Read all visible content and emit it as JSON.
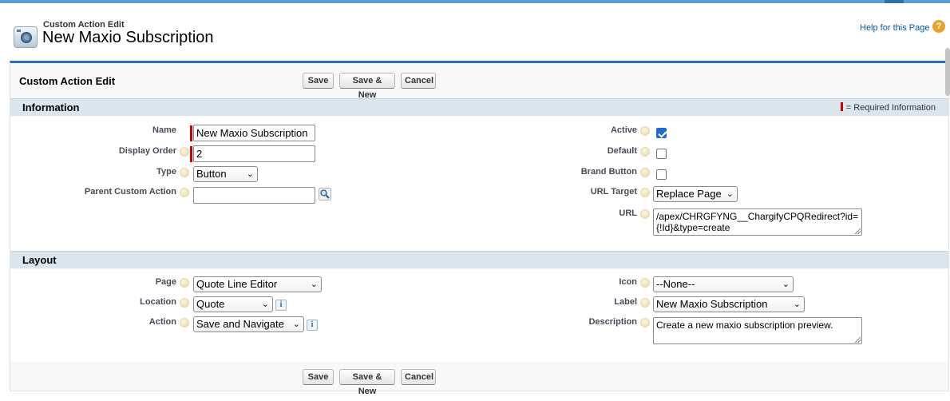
{
  "header": {
    "subtitle": "Custom Action Edit",
    "title": "New Maxio Subscription",
    "help_link": "Help for this Page",
    "help_icon": "?"
  },
  "page_block": {
    "title": "Custom Action Edit",
    "buttons": {
      "save": "Save",
      "save_new": "Save & New",
      "cancel": "Cancel"
    }
  },
  "information": {
    "heading": "Information",
    "required_legend": "= Required Information",
    "fields": {
      "name": {
        "label": "Name",
        "value": "New Maxio Subscription"
      },
      "display_order": {
        "label": "Display Order",
        "value": "2"
      },
      "type": {
        "label": "Type",
        "value": "Button"
      },
      "parent_custom_action": {
        "label": "Parent Custom Action",
        "value": ""
      },
      "active": {
        "label": "Active",
        "checked": true
      },
      "default": {
        "label": "Default",
        "checked": false
      },
      "brand_button": {
        "label": "Brand Button",
        "checked": false
      },
      "url_target": {
        "label": "URL Target",
        "value": "Replace Page"
      },
      "url": {
        "label": "URL",
        "value": "/apex/CHRGFYNG__ChargifyCPQRedirect?id={!Id}&type=create"
      }
    }
  },
  "layout": {
    "heading": "Layout",
    "fields": {
      "page": {
        "label": "Page",
        "value": "Quote Line Editor"
      },
      "location": {
        "label": "Location",
        "value": "Quote"
      },
      "action": {
        "label": "Action",
        "value": "Save and Navigate"
      },
      "icon": {
        "label": "Icon",
        "value": "--None--"
      },
      "label": {
        "label": "Label",
        "value": "New Maxio Subscription"
      },
      "description": {
        "label": "Description",
        "value": "Create a new maxio subscription preview."
      }
    }
  },
  "icons": {
    "info": "i",
    "chevron": "⌄"
  },
  "colors": {
    "accent": "#236fbd",
    "section_bg": "#dbe5ee",
    "required": "#cc0000",
    "checkbox_on": "#1f6bd6"
  }
}
